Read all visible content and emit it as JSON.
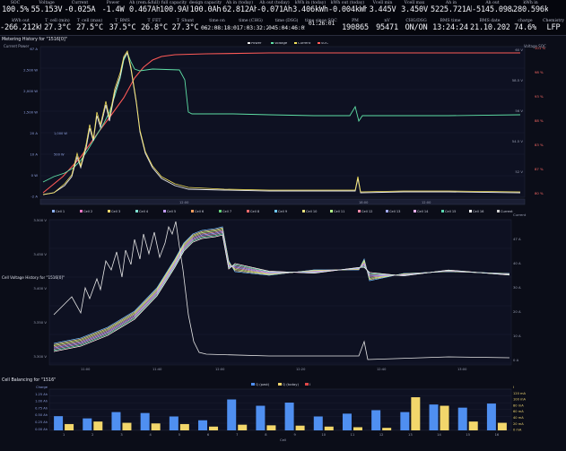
{
  "header": {
    "row1": [
      {
        "label": "SOC",
        "value": "100.5%"
      },
      {
        "label": "Voltage",
        "value": "55.153V"
      },
      {
        "label": "Current",
        "value": "-0.025A"
      },
      {
        "label": "Power",
        "value": "-1.4W"
      },
      {
        "label": "Ah (rem.&full)",
        "value": "0.467Ah"
      },
      {
        "label": "full capacity",
        "value": "100.9Ah"
      },
      {
        "label": "design capacity",
        "value": "100.0Ah"
      },
      {
        "label": "Ah in (today)",
        "value": "62.812Ah"
      },
      {
        "label": "Ah out (today)",
        "value": "-0.071Ah"
      },
      {
        "label": "kWh in (today)",
        "value": "3.406kWh"
      },
      {
        "label": "kWh out (today)",
        "value": "-0.004kWh"
      },
      {
        "label": "Vcell min",
        "value": "3.445V"
      },
      {
        "label": "Vcell max",
        "value": "3.450V"
      },
      {
        "label": "Ah in",
        "value": "5225.721Ah"
      },
      {
        "label": "Ah out",
        "value": "-5145.098Ah"
      },
      {
        "label": "kWh in",
        "value": "280.596kWh"
      }
    ],
    "row2": [
      {
        "label": "kWh out",
        "value": "-266.212kWh"
      },
      {
        "label": "T_cell (min)",
        "value": "27.3°C"
      },
      {
        "label": "T_cell (max)",
        "value": "27.5°C"
      },
      {
        "label": "T_BMS",
        "value": "37.5°C"
      },
      {
        "label": "T_FET",
        "value": "26.8°C"
      },
      {
        "label": "T_Shunt",
        "value": "27.3°C"
      },
      {
        "label": "time on",
        "value": "062:08:18:33"
      },
      {
        "label": "time (CHG)",
        "value": "017:03:32:28"
      },
      {
        "label": "time (DSG)",
        "value": "045:04:46:05"
      },
      {
        "label": "time since SOC 100",
        "value": "01:26:01"
      },
      {
        "label": "PM",
        "value": "190865"
      },
      {
        "label": "nV",
        "value": "95471"
      },
      {
        "label": "CHG/DSG",
        "value": "ON/ON"
      },
      {
        "label": "BMS time",
        "value": "13:24:24"
      },
      {
        "label": "BMS date",
        "value": "21.10.2025"
      },
      {
        "label": "charge",
        "value": "74.6%"
      },
      {
        "label": "Chemistry",
        "value": "LFP"
      }
    ]
  },
  "metering": {
    "title": "Metering History for \"1516[0]\"",
    "sub_left": "Current Power",
    "sub_right": "Voltage SOC",
    "legend": [
      "Power",
      "Voltage",
      "Current",
      "SOC"
    ],
    "left_ticks": [
      "67 A",
      "2,500 W",
      "2,000 W",
      "1,500 W",
      "20 A",
      "10 A",
      "0 W",
      "-2 A"
    ],
    "left_ticks2": [
      "",
      "",
      "",
      "",
      "1,000 W",
      "500 W",
      "",
      ""
    ],
    "right_ticks": [
      "60 V",
      "58.5 V",
      "56 V",
      "54.5 V",
      "52 V"
    ],
    "soc_ticks": [
      "101 %",
      "98 %",
      "93 %",
      "88 %",
      "83 %",
      "87 %",
      "80 %"
    ],
    "nav_ticks": [
      "12:00",
      "18:00",
      "12:00"
    ]
  },
  "cellvoltage": {
    "title": "Cell Voltage History for \"1516[0]\"",
    "left_ticks": [
      "3.500 V",
      "3.450 V",
      "3.400 V",
      "3.350 V",
      "3.300 V"
    ],
    "right_ticks": [
      "Current",
      "47 A",
      "40 A",
      "30 A",
      "20 A",
      "10 A",
      "0 A"
    ],
    "legend": [
      "Cell 1",
      "Cell 2",
      "Cell 3",
      "Cell 4",
      "Cell 5",
      "Cell 6",
      "Cell 7",
      "Cell 8",
      "Cell 9",
      "Cell 10",
      "Cell 11",
      "Cell 12",
      "Cell 13",
      "Cell 14",
      "Cell 15",
      "Cell 16",
      "Current"
    ],
    "x_ticks": [
      "11:00",
      "11:40",
      "12:00",
      "12:20",
      "12:40",
      "13:00"
    ]
  },
  "balancing": {
    "title": "Cell Balancing for \"1516\"",
    "legend": [
      "Q (past)",
      "Q (today)",
      "I"
    ],
    "left_ticks": [
      "Charge",
      "1.25 Ah",
      "1.00 Ah",
      "0.75 Ah",
      "0.50 Ah",
      "0.25 Ah",
      "0.00 Ah"
    ],
    "right_ticks": [
      "I",
      "120 mA",
      "100 mA",
      "80 mA",
      "60 mA",
      "40 mA",
      "20 mA",
      "0 mA"
    ],
    "xlabel": "Cell",
    "cells": [
      "1",
      "2",
      "3",
      "4",
      "5",
      "6",
      "7",
      "8",
      "9",
      "10",
      "11",
      "12",
      "13",
      "14",
      "15",
      "16"
    ],
    "q_past": [
      0.45,
      0.38,
      0.58,
      0.55,
      0.44,
      0.32,
      0.98,
      0.78,
      0.88,
      0.44,
      0.53,
      0.64,
      0.58,
      0.82,
      0.72,
      0.85
    ],
    "q_today": [
      0.2,
      0.28,
      0.24,
      0.22,
      0.2,
      0.12,
      0.18,
      0.16,
      0.15,
      0.12,
      0.1,
      0.08,
      1.05,
      0.78,
      0.28,
      0.24
    ],
    "colors": {
      "past": "#4f8ff0",
      "today": "#f2d66b",
      "current": "#e04848"
    }
  }
}
